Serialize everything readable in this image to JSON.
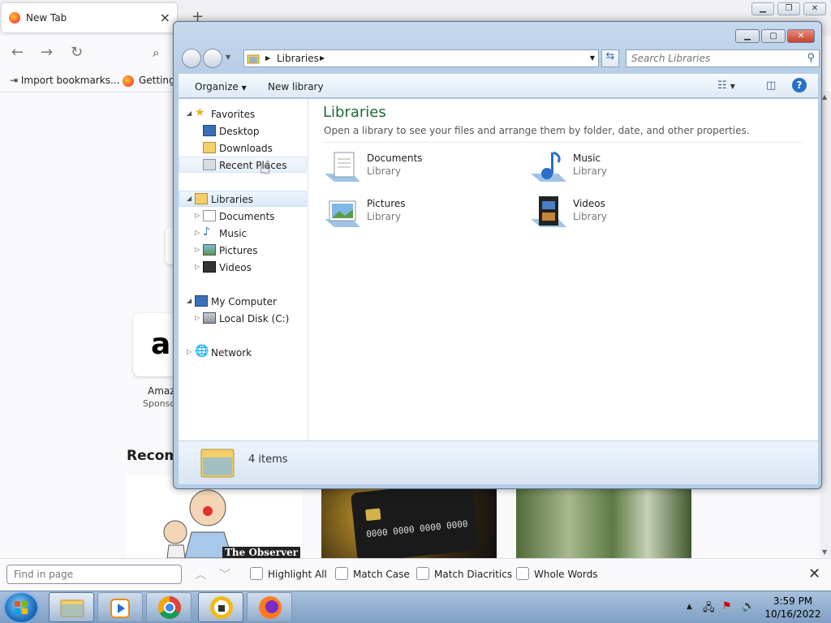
{
  "firefox": {
    "tab_title": "New Tab",
    "bookmarks": [
      "Import bookmarks...",
      "Getting"
    ],
    "amazon_letter": "a",
    "amazon_label": "Amaz",
    "amazon_sponsor": "Sponso",
    "recommended": "Recomm",
    "observer_text": "The Observer",
    "card_number": "0000 0000 0000 0000"
  },
  "findbar": {
    "placeholder": "Find in page",
    "options": [
      "Highlight All",
      "Match Case",
      "Match Diacritics",
      "Whole Words"
    ]
  },
  "explorer": {
    "address": "Libraries",
    "search_placeholder": "Search Libraries",
    "toolbar": {
      "organize": "Organize",
      "new_library": "New library"
    },
    "nav": {
      "favorites": "Favorites",
      "desktop": "Desktop",
      "downloads": "Downloads",
      "recent": "Recent Places",
      "libraries": "Libraries",
      "documents": "Documents",
      "music": "Music",
      "pictures": "Pictures",
      "videos": "Videos",
      "computer": "My Computer",
      "local_disk": "Local Disk (C:)",
      "network": "Network"
    },
    "content": {
      "title": "Libraries",
      "subtitle": "Open a library to see your files and arrange them by folder, date, and other properties.",
      "items": [
        {
          "name": "Documents",
          "type": "Library"
        },
        {
          "name": "Music",
          "type": "Library"
        },
        {
          "name": "Pictures",
          "type": "Library"
        },
        {
          "name": "Videos",
          "type": "Library"
        }
      ]
    },
    "details": {
      "count": "4 items"
    }
  },
  "taskbar": {
    "time": "3:59 PM",
    "date": "10/16/2022"
  },
  "colors": {
    "accent_green": "#1e6a35",
    "taskbar": "#8faacd"
  }
}
